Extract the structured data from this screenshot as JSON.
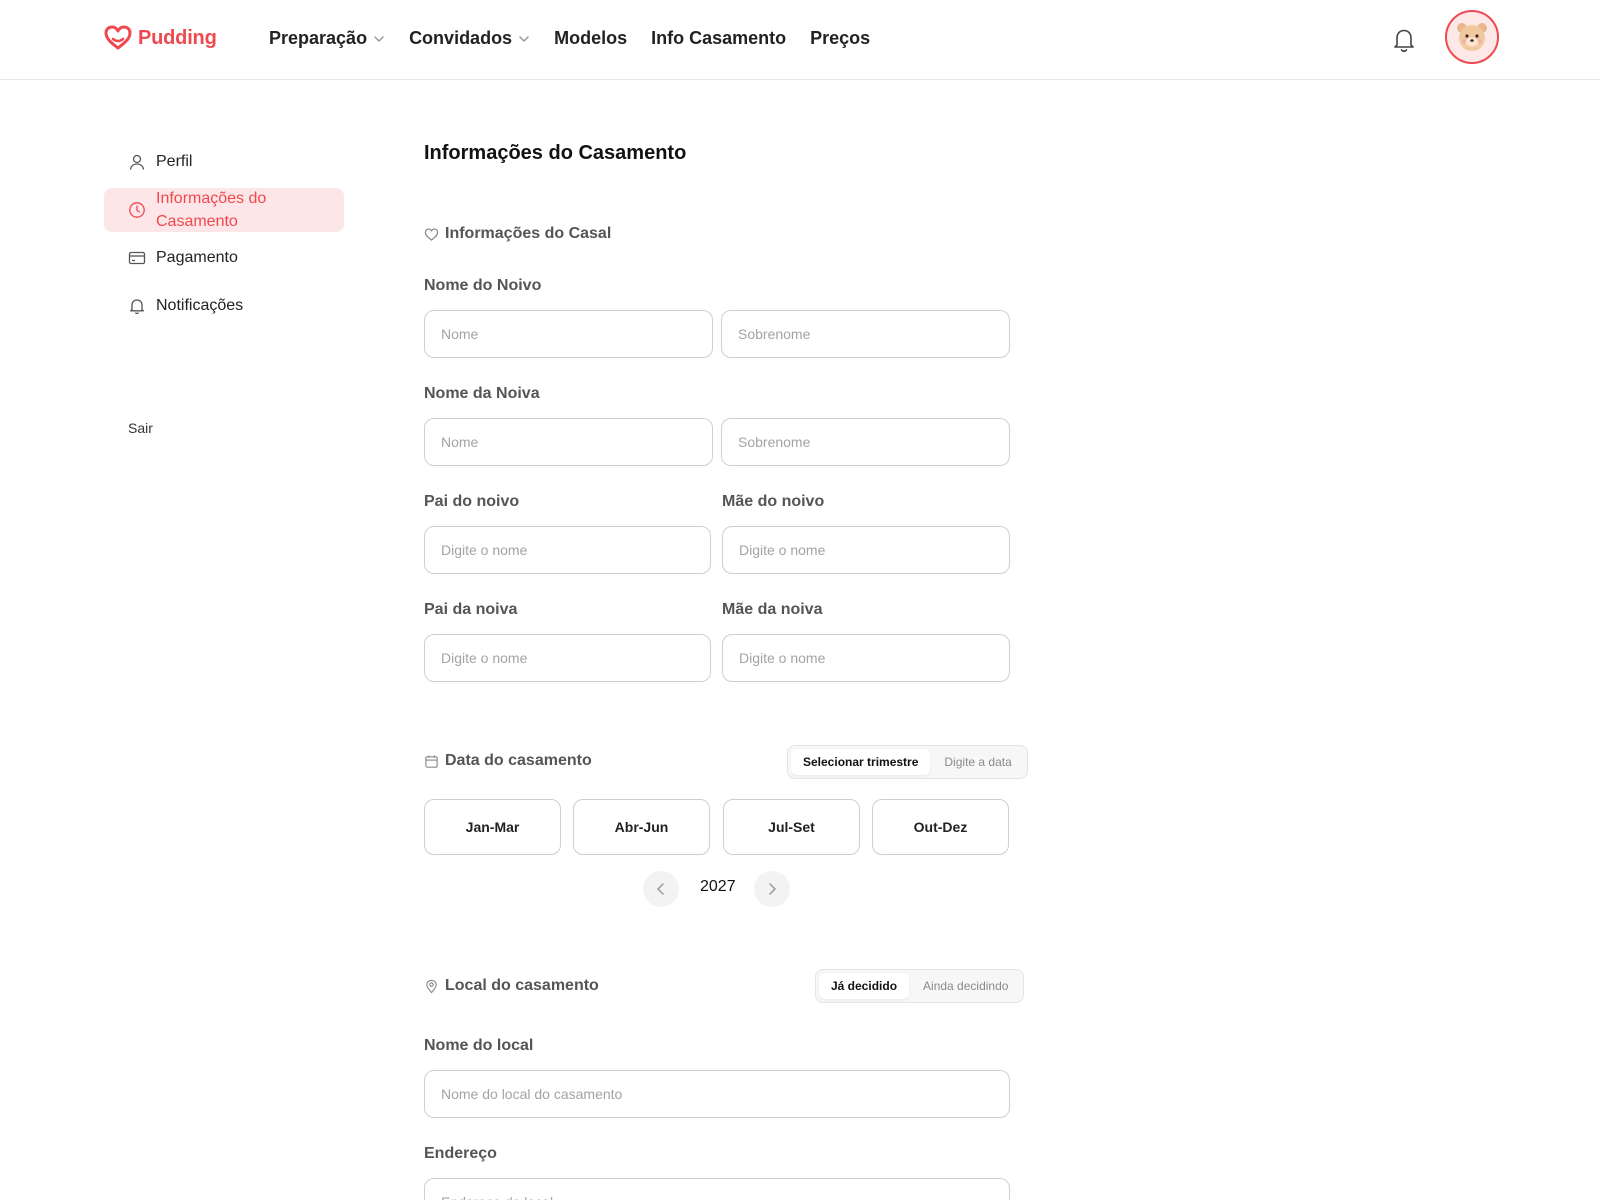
{
  "header": {
    "logo_text": "Pudding",
    "nav": [
      {
        "label": "Preparação",
        "has_dropdown": true
      },
      {
        "label": "Convidados",
        "has_dropdown": true
      },
      {
        "label": "Modelos",
        "has_dropdown": false
      },
      {
        "label": "Info Casamento",
        "has_dropdown": false
      },
      {
        "label": "Preços",
        "has_dropdown": false
      }
    ]
  },
  "sidebar": {
    "items": [
      {
        "label": "Perfil",
        "icon": "user-icon"
      },
      {
        "label": "Informações do Casamento",
        "icon": "clock-icon",
        "active": true
      },
      {
        "label": "Pagamento",
        "icon": "credit-card-icon"
      },
      {
        "label": "Notificações",
        "icon": "bell-icon"
      }
    ],
    "logout_label": "Sair"
  },
  "main": {
    "title": "Informações do Casamento",
    "couple_section": {
      "title": "Informações do Casal",
      "groom_label": "Nome do Noivo",
      "bride_label": "Nome da Noiva",
      "first_name_placeholder": "Nome",
      "last_name_placeholder": "Sobrenome",
      "groom_father_label": "Pai do noivo",
      "groom_mother_label": "Mãe do noivo",
      "bride_father_label": "Pai da noiva",
      "bride_mother_label": "Mãe da noiva",
      "name_placeholder": "Digite o nome"
    },
    "date_section": {
      "title": "Data do casamento",
      "toggle": [
        "Selecionar trimestre",
        "Digite a data"
      ],
      "toggle_selected": "Selecionar trimestre",
      "quarters": [
        "Jan-Mar",
        "Abr-Jun",
        "Jul-Set",
        "Out-Dez"
      ],
      "year": "2027"
    },
    "venue_section": {
      "title": "Local do casamento",
      "toggle": [
        "Já decidido",
        "Ainda decidindo"
      ],
      "toggle_selected": "Já decidido",
      "venue_label": "Nome do local",
      "venue_placeholder": "Nome do local do casamento",
      "address_label": "Endereço",
      "address_placeholder": "Endereço do local"
    }
  },
  "colors": {
    "accent": "#f0484e",
    "active_bg": "#fde6e7",
    "border": "#cfcfcf"
  }
}
